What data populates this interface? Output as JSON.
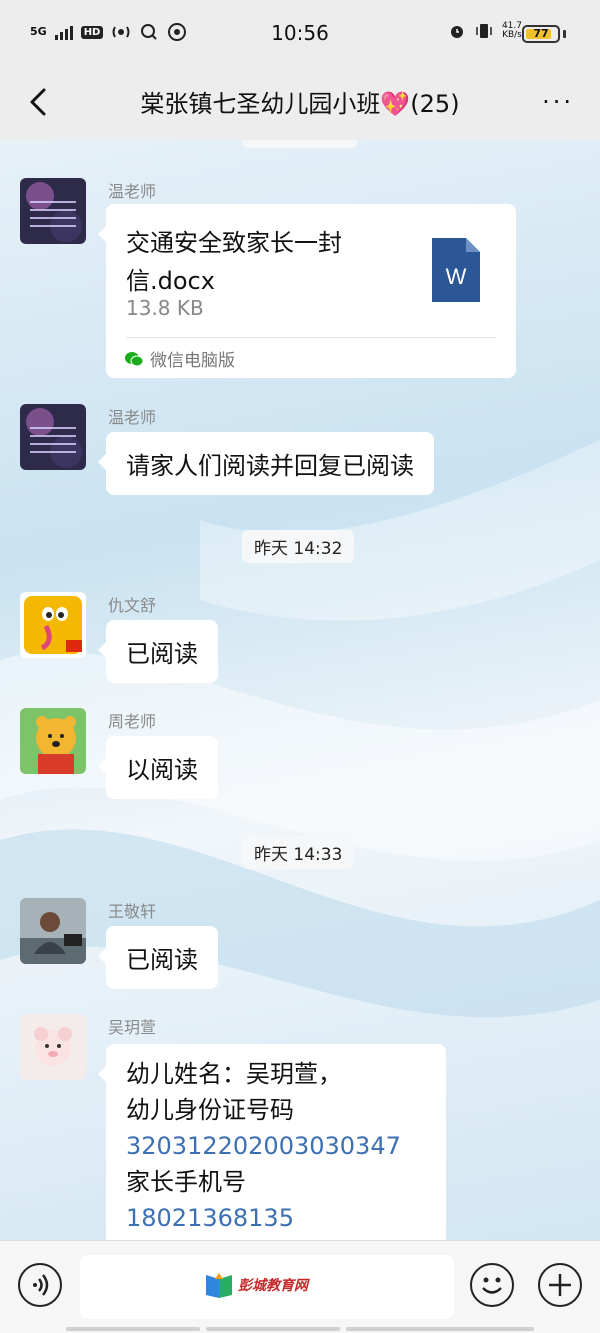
{
  "status_bar": {
    "network": "5G",
    "hd": "HD",
    "time": "10:56",
    "net_speed_value": "41.7",
    "net_speed_unit": "KB/s",
    "battery": "77"
  },
  "header": {
    "title": "棠张镇七圣幼儿园小班💖(25)",
    "more": "···"
  },
  "messages": {
    "m1": {
      "sender": "温老师",
      "file_name": "交通安全致家长一封信.docx",
      "file_size": "13.8 KB",
      "file_source": "微信电脑版",
      "file_icon_letter": "W"
    },
    "m2": {
      "sender": "温老师",
      "text": "请家人们阅读并回复已阅读"
    },
    "ts1": "昨天 14:32",
    "m3": {
      "sender": "仇文舒",
      "text": "已阅读"
    },
    "m4": {
      "sender": "周老师",
      "text": "以阅读"
    },
    "ts2": "昨天 14:33",
    "m5": {
      "sender": "王敬轩",
      "text": "已阅读"
    },
    "m6": {
      "sender": "吴玥萱",
      "line1": "幼儿姓名：吴玥萱，",
      "line2": "幼儿身份证号码",
      "id_number": "320312202003030347",
      "line4": "家长手机号",
      "phone": "18021368135"
    }
  },
  "input_bar": {
    "watermark": "彭城教育网"
  },
  "colors": {
    "link_blue": "#3d6fb3",
    "word_blue": "#2b5797",
    "wechat_green": "#1aad19"
  }
}
